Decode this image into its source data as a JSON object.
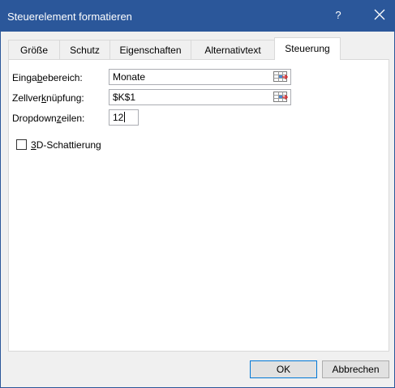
{
  "window": {
    "title": "Steuerelement formatieren",
    "help_label": "?",
    "titlebar_color": "#2b579a"
  },
  "tabs": [
    {
      "label": "Größe",
      "active": false
    },
    {
      "label": "Schutz",
      "active": false
    },
    {
      "label": "Eigenschaften",
      "active": false
    },
    {
      "label": "Alternativtext",
      "active": false
    },
    {
      "label": "Steuerung",
      "active": true
    }
  ],
  "fields": {
    "input_range": {
      "label_before": "Einga",
      "label_accel": "b",
      "label_after": "ebereich:",
      "value": "Monate",
      "icon": "range-selector-icon"
    },
    "cell_link": {
      "label_before": "Zellver",
      "label_accel": "k",
      "label_after": "nüpfung:",
      "value": "$K$1",
      "icon": "range-selector-icon"
    },
    "dropdown_lines": {
      "label_before": "Dropdown",
      "label_accel": "z",
      "label_after": "eilen:",
      "value": "12"
    }
  },
  "shading": {
    "label_accel": "3",
    "label_after": "D-Schattierung",
    "checked": false
  },
  "buttons": {
    "ok_label": "OK",
    "cancel_label": "Abbrechen"
  }
}
